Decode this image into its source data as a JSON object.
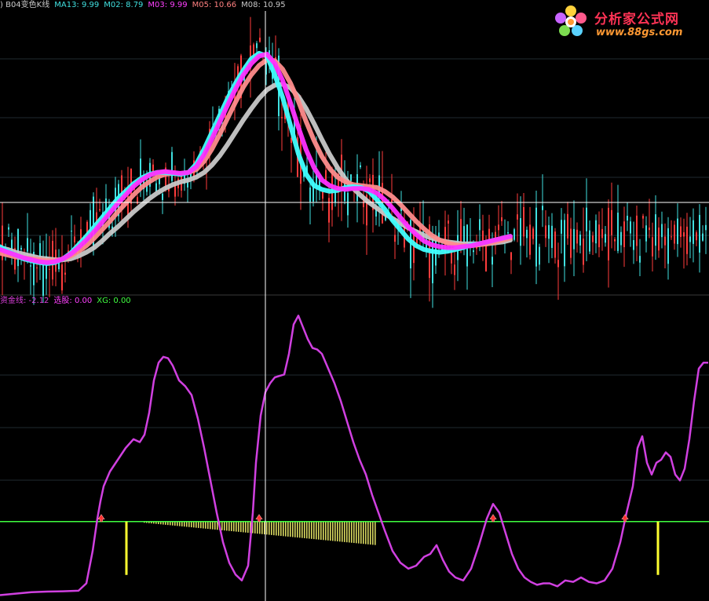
{
  "header_top": {
    "title": ") B04变色K线",
    "indicators": [
      {
        "label": "MA13: 9.99",
        "color": "#40e0e0"
      },
      {
        "label": "M02: 8.79",
        "color": "#40e0e0"
      },
      {
        "label": "M03: 9.99",
        "color": "#ff40ff"
      },
      {
        "label": "M05: 10.66",
        "color": "#ff8080"
      },
      {
        "label": "M08: 10.95",
        "color": "#c8c8c8"
      }
    ]
  },
  "header_bottom": {
    "indicators": [
      {
        "label": "资金线: -2.12",
        "color": "#e040e0"
      },
      {
        "label": "选股: 0.00",
        "color": "#ff40ff"
      },
      {
        "label": "XG: 0.00",
        "color": "#40ff40"
      }
    ]
  },
  "logo": {
    "title": "分析家公式网",
    "url": "www.88gs.com"
  },
  "colors": {
    "up": "#ff3c3c",
    "down": "#40e0e0",
    "ma_cyan": "#40ffff",
    "ma_magenta": "#ff30ff",
    "ma_salmon": "#ff8c8c",
    "ma_gray": "#c8c8c8",
    "fund_line": "#d040e0",
    "zero_line": "#40ff40",
    "signal_bar": "#ffff30",
    "histogram": "#d8d860",
    "grid": "#202a30",
    "crosshair": "#ffffff"
  },
  "chart_data": [
    {
      "type": "line",
      "name": "B04变色K线",
      "x": [
        0,
        10,
        20,
        30,
        40,
        50,
        60,
        70,
        80,
        90,
        100,
        110,
        120,
        130,
        140,
        150,
        160,
        170,
        180,
        190,
        200,
        210,
        220,
        230,
        240,
        250,
        260,
        270,
        280,
        290,
        300,
        310,
        320,
        330,
        340,
        350,
        360,
        370,
        380,
        390,
        400,
        410,
        420,
        430,
        440,
        450,
        460,
        470,
        480,
        490,
        500,
        510,
        520,
        530,
        540,
        550,
        560,
        570,
        580,
        590,
        600,
        610,
        620,
        630,
        640,
        650,
        660,
        670,
        680,
        690,
        700,
        710,
        720,
        730,
        740,
        750,
        760,
        770,
        780,
        790,
        800,
        810,
        820,
        830,
        840,
        850,
        860,
        870,
        880,
        890,
        900
      ],
      "series": [
        {
          "name": "MA13",
          "values": [
            8.79,
            8.74,
            8.7,
            8.66,
            8.64,
            8.62,
            8.61,
            8.62,
            8.66,
            8.72,
            8.81,
            8.9,
            9.0,
            9.1,
            9.2,
            9.3,
            9.38,
            9.46,
            9.52,
            9.56,
            9.58,
            9.58,
            9.57,
            9.56,
            9.58,
            9.67,
            9.83,
            10.01,
            10.19,
            10.37,
            10.53,
            10.67,
            10.79,
            10.85,
            10.82,
            10.62,
            10.38,
            10.08,
            9.78,
            9.56,
            9.44,
            9.4,
            9.38,
            9.39,
            9.42,
            9.43,
            9.42,
            9.38,
            9.29,
            9.19,
            9.07,
            8.97,
            8.87,
            8.8,
            8.76,
            8.74,
            8.73,
            8.74,
            8.76,
            8.78,
            8.81,
            8.82,
            8.84,
            8.86,
            8.88,
            8.9
          ]
        },
        {
          "name": "M03",
          "values": [
            8.76,
            8.73,
            8.7,
            8.67,
            8.65,
            8.63,
            8.62,
            8.63,
            8.66,
            8.71,
            8.78,
            8.86,
            8.95,
            9.05,
            9.15,
            9.25,
            9.34,
            9.43,
            9.5,
            9.55,
            9.58,
            9.59,
            9.58,
            9.57,
            9.58,
            9.64,
            9.77,
            9.94,
            10.12,
            10.3,
            10.47,
            10.62,
            10.74,
            10.82,
            10.84,
            10.74,
            10.56,
            10.32,
            10.06,
            9.82,
            9.63,
            9.5,
            9.44,
            9.41,
            9.4,
            9.41,
            9.41,
            9.4,
            9.36,
            9.29,
            9.2,
            9.1,
            9.0,
            8.92,
            8.85,
            8.81,
            8.79,
            8.78,
            8.78,
            8.79,
            8.8,
            8.82,
            8.84,
            8.86,
            8.88,
            8.9
          ]
        },
        {
          "name": "M05",
          "values": [
            8.72,
            8.7,
            8.68,
            8.67,
            8.66,
            8.65,
            8.64,
            8.64,
            8.66,
            8.69,
            8.74,
            8.8,
            8.88,
            8.97,
            9.06,
            9.16,
            9.25,
            9.34,
            9.42,
            9.48,
            9.53,
            9.56,
            9.57,
            9.57,
            9.58,
            9.61,
            9.7,
            9.83,
            9.99,
            10.16,
            10.33,
            10.49,
            10.62,
            10.72,
            10.78,
            10.77,
            10.68,
            10.53,
            10.34,
            10.12,
            9.92,
            9.75,
            9.62,
            9.53,
            9.48,
            9.45,
            9.44,
            9.43,
            9.42,
            9.38,
            9.32,
            9.24,
            9.15,
            9.06,
            8.98,
            8.91,
            8.86,
            8.83,
            8.81,
            8.8,
            8.8,
            8.81,
            8.82,
            8.84,
            8.86,
            8.88
          ]
        },
        {
          "name": "M08",
          "values": [
            8.78,
            8.76,
            8.73,
            8.71,
            8.69,
            8.67,
            8.66,
            8.65,
            8.65,
            8.66,
            8.69,
            8.73,
            8.78,
            8.85,
            8.93,
            9.0,
            9.08,
            9.16,
            9.23,
            9.3,
            9.36,
            9.41,
            9.45,
            9.48,
            9.5,
            9.53,
            9.58,
            9.66,
            9.76,
            9.88,
            10.01,
            10.14,
            10.26,
            10.37,
            10.46,
            10.51,
            10.52,
            10.48,
            10.39,
            10.26,
            10.1,
            9.93,
            9.77,
            9.63,
            9.51,
            9.41,
            9.33,
            9.26,
            9.2,
            9.14,
            9.09,
            9.04,
            8.99,
            8.95,
            8.91,
            8.88,
            8.86,
            8.84,
            8.83,
            8.82,
            8.82,
            8.82,
            8.82,
            8.83,
            8.84,
            8.86
          ]
        }
      ],
      "ylim": [
        8.3,
        11.3
      ]
    },
    {
      "type": "line",
      "name": "资金线",
      "x": [
        0,
        20,
        40,
        60,
        80,
        100,
        110,
        118,
        124,
        128,
        132,
        140,
        150,
        160,
        170,
        178,
        184,
        190,
        196,
        202,
        208,
        214,
        220,
        228,
        236,
        244,
        252,
        260,
        268,
        276,
        284,
        292,
        300,
        308,
        316,
        322,
        326,
        332,
        338,
        344,
        350,
        356,
        362,
        368,
        374,
        380,
        386,
        392,
        398,
        404,
        410,
        418,
        426,
        434,
        442,
        450,
        458,
        466,
        474,
        482,
        490,
        500,
        510,
        520,
        530,
        540,
        548,
        556,
        564,
        572,
        580,
        590,
        600,
        610,
        620,
        628,
        636,
        644,
        652,
        660,
        668,
        676,
        684,
        692,
        700,
        710,
        720,
        730,
        740,
        750,
        760,
        770,
        780,
        790,
        798,
        806,
        812,
        818,
        824,
        830,
        836,
        842,
        848,
        854,
        860,
        866,
        872,
        878,
        884,
        890,
        896,
        902
      ],
      "values": [
        -2.5,
        -2.45,
        -2.4,
        -2.38,
        -2.37,
        -2.35,
        -2.1,
        -1.0,
        0.1,
        0.7,
        1.2,
        1.7,
        2.1,
        2.5,
        2.8,
        2.7,
        2.95,
        3.7,
        4.8,
        5.4,
        5.6,
        5.55,
        5.3,
        4.8,
        4.6,
        4.3,
        3.5,
        2.5,
        1.4,
        0.3,
        -0.7,
        -1.4,
        -1.8,
        -2.0,
        -1.5,
        0.3,
        2.0,
        3.6,
        4.4,
        4.7,
        4.9,
        4.95,
        5.0,
        5.7,
        6.7,
        7.0,
        6.6,
        6.2,
        5.9,
        5.85,
        5.7,
        5.2,
        4.7,
        4.1,
        3.4,
        2.7,
        2.1,
        1.6,
        0.9,
        0.3,
        -0.3,
        -1.0,
        -1.4,
        -1.6,
        -1.5,
        -1.2,
        -1.1,
        -0.8,
        -1.3,
        -1.7,
        -1.9,
        -2.0,
        -1.6,
        -0.8,
        0.1,
        0.6,
        0.3,
        -0.4,
        -1.1,
        -1.6,
        -1.9,
        -2.05,
        -2.15,
        -2.1,
        -2.1,
        -2.2,
        -2.0,
        -2.05,
        -1.9,
        -2.05,
        -2.1,
        -2.0,
        -1.6,
        -0.7,
        0.3,
        1.2,
        2.5,
        2.9,
        2.0,
        1.6,
        2.0,
        2.1,
        2.35,
        2.2,
        1.6,
        1.4,
        1.8,
        2.8,
        4.1,
        5.2,
        5.4,
        5.4
      ],
      "zero": 0,
      "ylim": [
        -2.7,
        7.3
      ]
    },
    {
      "type": "bar",
      "name": "选股",
      "x": [
        161,
        838
      ],
      "values": [
        1,
        1
      ]
    },
    {
      "type": "bar",
      "name": "XG",
      "x_start": 183,
      "x_end": 478,
      "start_value": 0.05,
      "end_value": 1.0
    },
    {
      "type": "scatter",
      "name": "signal-arrows",
      "x": [
        129,
        330,
        628,
        796
      ],
      "values": [
        0,
        0,
        0,
        0
      ]
    }
  ]
}
